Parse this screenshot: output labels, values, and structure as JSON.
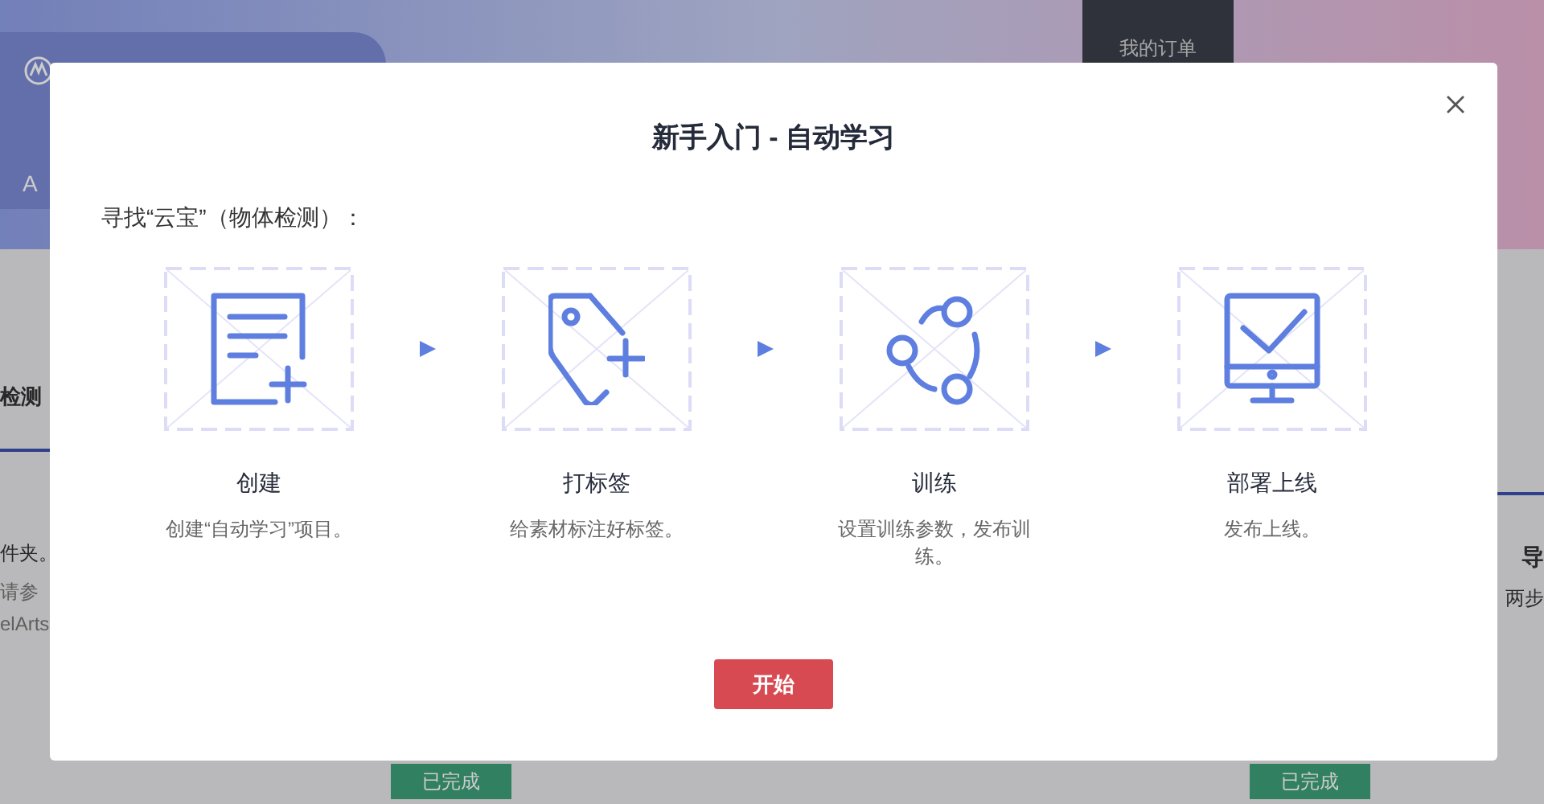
{
  "background": {
    "banner_texts": [
      "A"
    ],
    "menu_item": "我的订单",
    "left_texts": [
      "检测",
      "件夹。",
      "请参",
      "elArts"
    ],
    "right_texts": [
      "导",
      "两步"
    ],
    "status_buttons": [
      "已完成",
      "已完成"
    ]
  },
  "dialog": {
    "title": "新手入门 - 自动学习",
    "subtitle": "寻找“云宝”（物体检测）：",
    "steps": [
      {
        "kind": "document",
        "title": "创建",
        "description": "创建“自动学习”项目。"
      },
      {
        "kind": "tag",
        "title": "打标签",
        "description": "给素材标注好标签。"
      },
      {
        "kind": "network",
        "title": "训练",
        "description": "设置训练参数，发布训练。"
      },
      {
        "kind": "monitor",
        "title": "部署上线",
        "description": "发布上线。"
      }
    ],
    "start_button": "开始"
  }
}
